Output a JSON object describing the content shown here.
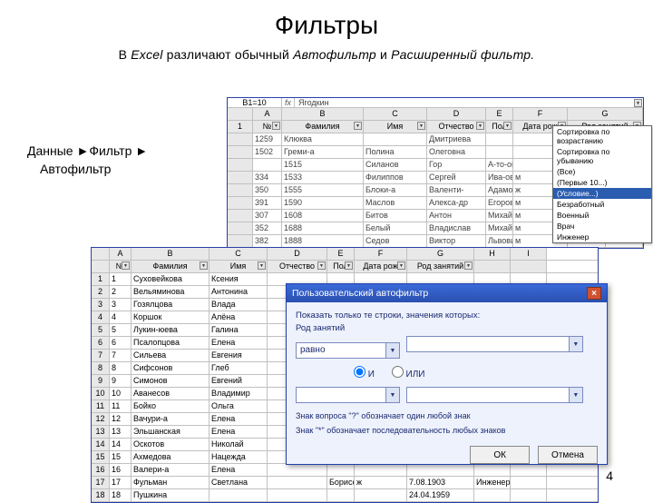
{
  "title": "Фильтры",
  "subtitle_plain_1": "В ",
  "subtitle_it_1": "Excel ",
  "subtitle_plain_2": "различают обычный ",
  "subtitle_it_2": "Автофильтр ",
  "subtitle_plain_3": "и ",
  "subtitle_it_3": "Расширенный фильтр.",
  "navpath_l1": "Данные ►Фильтр ►",
  "navpath_l2": "Автофильтр",
  "page_number": "4",
  "back": {
    "namebox": {
      "ref": "B1=10",
      "fx": "fx",
      "val": "Ягодкин"
    },
    "col_letters": [
      "A",
      "B",
      "C",
      "D",
      "E",
      "F",
      "G"
    ],
    "headers": [
      "№",
      "Фамилия",
      "Имя",
      "Отчество",
      "Пол",
      "Дата рож",
      "Род занятий"
    ],
    "rows": [
      [
        "",
        "1259",
        "Клюква",
        "",
        "Дмитриева",
        "",
        "",
        ""
      ],
      [
        "",
        "1502",
        "Греми-а",
        "Полина",
        "Олеговна",
        "",
        "",
        ""
      ],
      [
        "",
        "",
        "1515",
        "Силанов",
        "Гор",
        "А-то-ови",
        "",
        "",
        ""
      ],
      [
        "",
        "334",
        "1533",
        "Филиппов",
        "Сергей",
        "Ива-ович",
        "м",
        "",
        ""
      ],
      [
        "",
        "350",
        "1555",
        "Блоки-а",
        "Валенти-",
        "Адамовна",
        "ж",
        "",
        ""
      ],
      [
        "",
        "391",
        "1590",
        "Маслов",
        "Алекса-др",
        "Егорович",
        "м",
        "",
        ""
      ],
      [
        "",
        "307",
        "1608",
        "Битов",
        "Антон",
        "Михайлович",
        "м",
        "",
        ""
      ],
      [
        "",
        "352",
        "1688",
        "Белый",
        "Владислав",
        "Михайлович",
        "м",
        "",
        ""
      ],
      [
        "",
        "382",
        "1888",
        "Седов",
        "Виктор",
        "Львович",
        "м",
        "",
        ""
      ]
    ]
  },
  "filter_list": {
    "items": [
      "Сортировка по возрастанию",
      "Сортировка по убыванию",
      "(Все)",
      "(Первые 10...)",
      "(Условие...)",
      "Безработный",
      "Военный",
      "Врач",
      "Инженер"
    ],
    "selected_index": 4
  },
  "front": {
    "col_letters": [
      "",
      "A",
      "B",
      "C",
      "D",
      "E",
      "F",
      "G",
      "H",
      "I"
    ],
    "headers": [
      "",
      "№",
      "Фамилия",
      "Имя",
      "Отчество",
      "Пол",
      "Дата рож",
      "Род занятий",
      "",
      ""
    ],
    "rows": [
      [
        "1",
        "1",
        "Суховейкова",
        "Ксения",
        "",
        "",
        "",
        "",
        "",
        ""
      ],
      [
        "2",
        "2",
        "Вельяминова",
        "Антонина",
        "",
        "",
        "",
        "",
        "",
        ""
      ],
      [
        "3",
        "3",
        "Гозялцова",
        "Влада",
        "",
        "",
        "",
        "",
        "",
        ""
      ],
      [
        "4",
        "4",
        "Коршок",
        "Алёна",
        "",
        "",
        "",
        "",
        "",
        ""
      ],
      [
        "5",
        "5",
        "Лукин-юева",
        "Галина",
        "",
        "",
        "",
        "",
        "",
        ""
      ],
      [
        "6",
        "6",
        "Псалопцова",
        "Елена",
        "",
        "",
        "",
        "",
        "",
        ""
      ],
      [
        "7",
        "7",
        "Сильева",
        "Евгения",
        "",
        "",
        "",
        "",
        "",
        ""
      ],
      [
        "8",
        "8",
        "Сифсонов",
        "Глеб",
        "",
        "",
        "",
        "",
        "",
        ""
      ],
      [
        "9",
        "9",
        "Симонов",
        "Евгений",
        "",
        "",
        "",
        "",
        "",
        ""
      ],
      [
        "10",
        "10",
        "Аванесов",
        "Владимир",
        "",
        "",
        "",
        "",
        "",
        ""
      ],
      [
        "11",
        "11",
        "Бойко",
        "Ольга",
        "",
        "",
        "",
        "",
        "",
        ""
      ],
      [
        "12",
        "12",
        "Вачури-а",
        "Елена",
        "",
        "",
        "",
        "",
        "",
        ""
      ],
      [
        "13",
        "13",
        "Эльшанская",
        "Елена",
        "",
        "",
        "",
        "",
        "",
        ""
      ],
      [
        "14",
        "14",
        "Оскотов",
        "Николай",
        "",
        "",
        "",
        "",
        "",
        ""
      ],
      [
        "15",
        "15",
        "Ахмедова",
        "Нацежда",
        "",
        "",
        "",
        "",
        "",
        ""
      ],
      [
        "16",
        "16",
        "Валери-а",
        "Елена",
        "",
        "",
        "",
        "",
        "",
        ""
      ],
      [
        "17",
        "17",
        "Фульман",
        "Светлана",
        "",
        "Борисовна",
        "ж",
        "7.08.1903",
        "Инженер",
        ""
      ],
      [
        "18",
        "18",
        "Пушкина",
        "",
        "",
        "",
        "",
        "24.04.1959",
        "",
        ""
      ]
    ]
  },
  "dlg": {
    "title": "Пользовательский автофильтр",
    "line1": "Показать только те строки, значения которых:",
    "field_label": "Род занятий",
    "op1": "равно",
    "val1": "",
    "radio_and": "И",
    "radio_or": "ИЛИ",
    "op2": "",
    "val2": "",
    "hint1": "Знак вопроса \"?\" обозначает один любой знак",
    "hint2": "Знак \"*\" обозначает последовательность любых знаков",
    "ok": "ОК",
    "cancel": "Отмена"
  }
}
